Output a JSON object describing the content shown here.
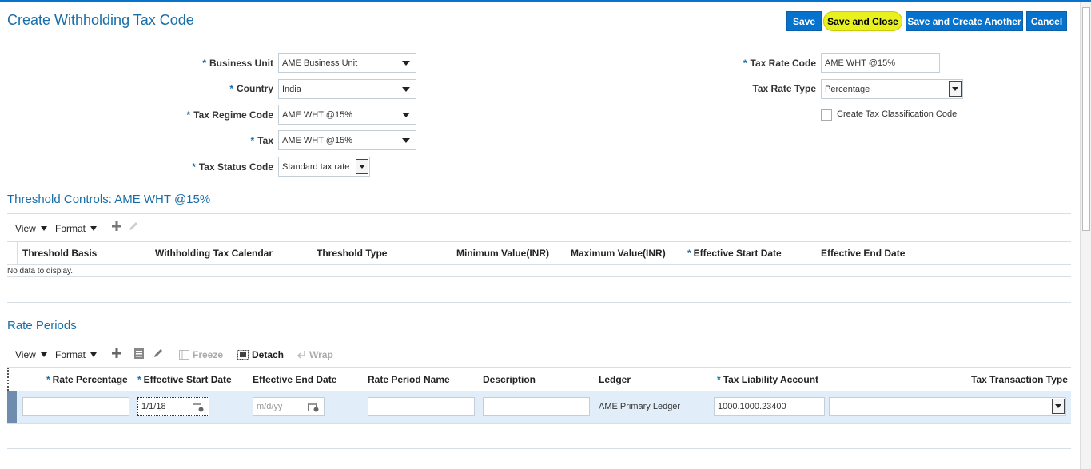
{
  "page": {
    "title": "Create Withholding Tax Code"
  },
  "actions": {
    "save": "Save",
    "save_close": "Save and Close",
    "save_create": "Save and Create Another",
    "cancel": "Cancel"
  },
  "form": {
    "business_unit": {
      "label": "Business Unit",
      "value": "AME Business Unit"
    },
    "country": {
      "label": "Country",
      "value": "India"
    },
    "tax_regime_code": {
      "label": "Tax Regime Code",
      "value": "AME WHT @15%"
    },
    "tax": {
      "label": "Tax",
      "value": "AME WHT @15%"
    },
    "tax_status_code": {
      "label": "Tax Status Code",
      "value": "Standard tax rate"
    },
    "tax_rate_code": {
      "label": "Tax Rate Code",
      "value": "AME WHT @15%"
    },
    "tax_rate_type": {
      "label": "Tax Rate Type",
      "value": "Percentage"
    },
    "create_tax_classification": {
      "label": "Create Tax Classification Code",
      "checked": false
    }
  },
  "threshold": {
    "title": "Threshold Controls: AME WHT @15%",
    "view": "View",
    "format": "Format",
    "columns": [
      "Threshold Basis",
      "Withholding Tax Calendar",
      "Threshold Type",
      "Minimum Value(INR)",
      "Maximum Value(INR)",
      "Effective Start Date",
      "Effective End Date"
    ],
    "empty": "No data to display."
  },
  "rate_periods": {
    "title": "Rate Periods",
    "view": "View",
    "format": "Format",
    "freeze": "Freeze",
    "detach": "Detach",
    "wrap": "Wrap",
    "columns": [
      "Rate Percentage",
      "Effective Start Date",
      "Effective End Date",
      "Rate Period Name",
      "Description",
      "Ledger",
      "Tax Liability Account",
      "Tax Transaction Type"
    ],
    "row": {
      "rate_percentage": "",
      "effective_start_date": "1/1/18",
      "effective_end_date_placeholder": "m/d/yy",
      "rate_period_name": "",
      "description": "",
      "ledger": "AME Primary Ledger",
      "tax_liability_account": "1000.1000.23400",
      "tax_transaction_type": ""
    }
  },
  "colors": {
    "accent": "#0572ce",
    "title": "#1a6ea8",
    "highlight": "#e8f020"
  }
}
